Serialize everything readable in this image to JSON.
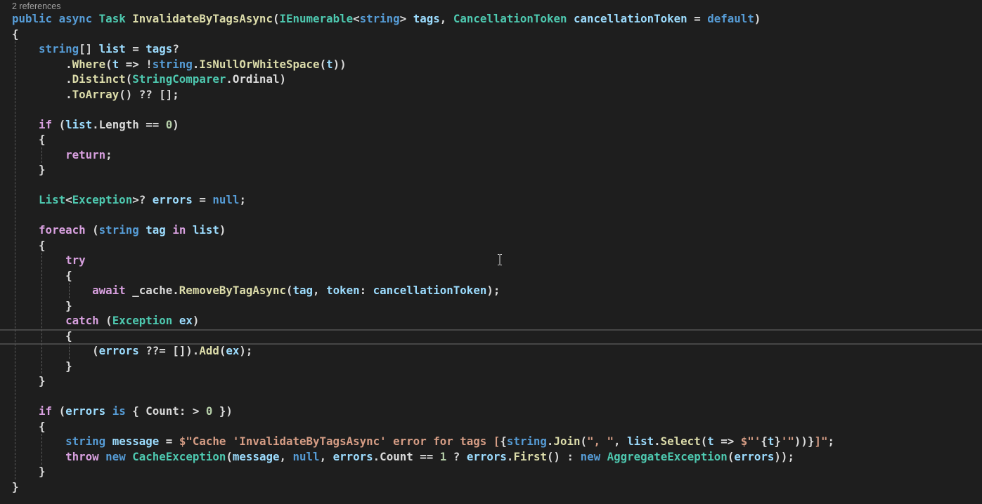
{
  "codelens": {
    "references": "2 references"
  },
  "colors": {
    "background": "#1e1e1e",
    "keyword": "#569cd6",
    "control": "#d8a0df",
    "type": "#4ec9b0",
    "method": "#dcdcaa",
    "variable": "#9cdcfe",
    "string": "#d69d85",
    "number": "#b5cea8"
  },
  "lines": [
    [
      [
        "k",
        "public"
      ],
      [
        "p",
        " "
      ],
      [
        "k",
        "async"
      ],
      [
        "p",
        " "
      ],
      [
        "t",
        "Task"
      ],
      [
        "p",
        " "
      ],
      [
        "m",
        "InvalidateByTagsAsync"
      ],
      [
        "p",
        "("
      ],
      [
        "t",
        "IEnumerable"
      ],
      [
        "p",
        "<"
      ],
      [
        "k",
        "string"
      ],
      [
        "p",
        "> "
      ],
      [
        "v",
        "tags"
      ],
      [
        "p",
        ", "
      ],
      [
        "t",
        "CancellationToken"
      ],
      [
        "p",
        " "
      ],
      [
        "v",
        "cancellationToken"
      ],
      [
        "p",
        " = "
      ],
      [
        "k",
        "default"
      ],
      [
        "p",
        ")"
      ]
    ],
    [
      [
        "p",
        "{"
      ]
    ],
    [
      [
        "p",
        "    "
      ],
      [
        "k",
        "string"
      ],
      [
        "p",
        "[] "
      ],
      [
        "v",
        "list"
      ],
      [
        "p",
        " = "
      ],
      [
        "v",
        "tags"
      ],
      [
        "p",
        "?"
      ]
    ],
    [
      [
        "p",
        "        ."
      ],
      [
        "m",
        "Where"
      ],
      [
        "p",
        "("
      ],
      [
        "v",
        "t"
      ],
      [
        "p",
        " => !"
      ],
      [
        "k",
        "string"
      ],
      [
        "p",
        "."
      ],
      [
        "m",
        "IsNullOrWhiteSpace"
      ],
      [
        "p",
        "("
      ],
      [
        "v",
        "t"
      ],
      [
        "p",
        "))"
      ]
    ],
    [
      [
        "p",
        "        ."
      ],
      [
        "m",
        "Distinct"
      ],
      [
        "p",
        "("
      ],
      [
        "t",
        "StringComparer"
      ],
      [
        "p",
        ".Ordinal)"
      ]
    ],
    [
      [
        "p",
        "        ."
      ],
      [
        "m",
        "ToArray"
      ],
      [
        "p",
        "() ?? [];"
      ]
    ],
    [],
    [
      [
        "p",
        "    "
      ],
      [
        "c",
        "if"
      ],
      [
        "p",
        " ("
      ],
      [
        "v",
        "list"
      ],
      [
        "p",
        ".Length == "
      ],
      [
        "n",
        "0"
      ],
      [
        "p",
        ")"
      ]
    ],
    [
      [
        "p",
        "    {"
      ]
    ],
    [
      [
        "p",
        "        "
      ],
      [
        "c",
        "return"
      ],
      [
        "p",
        ";"
      ]
    ],
    [
      [
        "p",
        "    }"
      ]
    ],
    [],
    [
      [
        "p",
        "    "
      ],
      [
        "t",
        "List"
      ],
      [
        "p",
        "<"
      ],
      [
        "t",
        "Exception"
      ],
      [
        "p",
        ">? "
      ],
      [
        "v",
        "errors"
      ],
      [
        "p",
        " = "
      ],
      [
        "k",
        "null"
      ],
      [
        "p",
        ";"
      ]
    ],
    [],
    [
      [
        "p",
        "    "
      ],
      [
        "c",
        "foreach"
      ],
      [
        "p",
        " ("
      ],
      [
        "k",
        "string"
      ],
      [
        "p",
        " "
      ],
      [
        "v",
        "tag"
      ],
      [
        "p",
        " "
      ],
      [
        "c",
        "in"
      ],
      [
        "p",
        " "
      ],
      [
        "v",
        "list"
      ],
      [
        "p",
        ")"
      ]
    ],
    [
      [
        "p",
        "    {"
      ]
    ],
    [
      [
        "p",
        "        "
      ],
      [
        "c",
        "try"
      ]
    ],
    [
      [
        "p",
        "        {"
      ]
    ],
    [
      [
        "p",
        "            "
      ],
      [
        "c",
        "await"
      ],
      [
        "p",
        " _cache."
      ],
      [
        "m",
        "RemoveByTagAsync"
      ],
      [
        "p",
        "("
      ],
      [
        "v",
        "tag"
      ],
      [
        "p",
        ", "
      ],
      [
        "v",
        "token"
      ],
      [
        "p",
        ": "
      ],
      [
        "v",
        "cancellationToken"
      ],
      [
        "p",
        ");"
      ]
    ],
    [
      [
        "p",
        "        }"
      ]
    ],
    [
      [
        "p",
        "        "
      ],
      [
        "c",
        "catch"
      ],
      [
        "p",
        " ("
      ],
      [
        "t",
        "Exception"
      ],
      [
        "p",
        " "
      ],
      [
        "v",
        "ex"
      ],
      [
        "p",
        ")"
      ]
    ],
    [
      [
        "p",
        "        {"
      ]
    ],
    [
      [
        "p",
        "            ("
      ],
      [
        "v",
        "errors"
      ],
      [
        "p",
        " ??= [])."
      ],
      [
        "m",
        "Add"
      ],
      [
        "p",
        "("
      ],
      [
        "v",
        "ex"
      ],
      [
        "p",
        ");"
      ]
    ],
    [
      [
        "p",
        "        }"
      ]
    ],
    [
      [
        "p",
        "    }"
      ]
    ],
    [],
    [
      [
        "p",
        "    "
      ],
      [
        "c",
        "if"
      ],
      [
        "p",
        " ("
      ],
      [
        "v",
        "errors"
      ],
      [
        "p",
        " "
      ],
      [
        "k",
        "is"
      ],
      [
        "p",
        " { Count: > "
      ],
      [
        "n",
        "0"
      ],
      [
        "p",
        " })"
      ]
    ],
    [
      [
        "p",
        "    {"
      ]
    ],
    [
      [
        "p",
        "        "
      ],
      [
        "k",
        "string"
      ],
      [
        "p",
        " "
      ],
      [
        "v",
        "message"
      ],
      [
        "p",
        " = "
      ],
      [
        "s",
        "$\"Cache 'InvalidateByTagsAsync' error for tags ["
      ],
      [
        "p",
        "{"
      ],
      [
        "k",
        "string"
      ],
      [
        "p",
        "."
      ],
      [
        "m",
        "Join"
      ],
      [
        "p",
        "("
      ],
      [
        "s",
        "\", \""
      ],
      [
        "p",
        ", "
      ],
      [
        "v",
        "list"
      ],
      [
        "p",
        "."
      ],
      [
        "m",
        "Select"
      ],
      [
        "p",
        "("
      ],
      [
        "v",
        "t"
      ],
      [
        "p",
        " => "
      ],
      [
        "s",
        "$\"'"
      ],
      [
        "p",
        "{"
      ],
      [
        "v",
        "t"
      ],
      [
        "p",
        "}"
      ],
      [
        "s",
        "'\""
      ],
      [
        "p",
        "))}"
      ],
      [
        "s",
        "]\""
      ],
      [
        "p",
        ";"
      ]
    ],
    [
      [
        "p",
        "        "
      ],
      [
        "c",
        "throw"
      ],
      [
        "p",
        " "
      ],
      [
        "k",
        "new"
      ],
      [
        "p",
        " "
      ],
      [
        "t",
        "CacheException"
      ],
      [
        "p",
        "("
      ],
      [
        "v",
        "message"
      ],
      [
        "p",
        ", "
      ],
      [
        "k",
        "null"
      ],
      [
        "p",
        ", "
      ],
      [
        "v",
        "errors"
      ],
      [
        "p",
        ".Count == "
      ],
      [
        "n",
        "1"
      ],
      [
        "p",
        " ? "
      ],
      [
        "v",
        "errors"
      ],
      [
        "p",
        "."
      ],
      [
        "m",
        "First"
      ],
      [
        "p",
        "() : "
      ],
      [
        "k",
        "new"
      ],
      [
        "p",
        " "
      ],
      [
        "t",
        "AggregateException"
      ],
      [
        "p",
        "("
      ],
      [
        "v",
        "errors"
      ],
      [
        "p",
        "));"
      ]
    ],
    [
      [
        "p",
        "    }"
      ]
    ],
    [
      [
        "p",
        "}"
      ]
    ]
  ]
}
